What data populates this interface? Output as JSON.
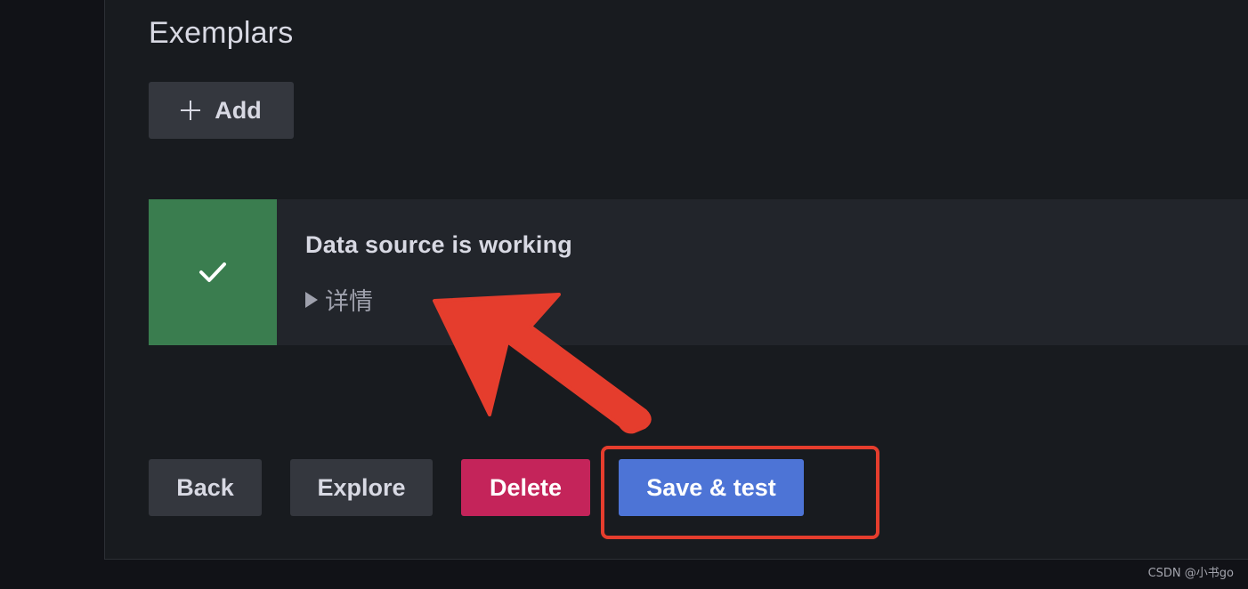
{
  "section": {
    "title": "Exemplars",
    "add_label": "Add"
  },
  "alert": {
    "status": "success",
    "title": "Data source is working",
    "details_label": "详情",
    "accent_color": "#3a7d4f"
  },
  "actions": {
    "back_label": "Back",
    "explore_label": "Explore",
    "delete_label": "Delete",
    "save_test_label": "Save & test"
  },
  "colors": {
    "background": "#181b1f",
    "secondary_button": "#34373e",
    "delete_button": "#c4245a",
    "primary_button": "#4d74d6",
    "annotation_red": "#e53d2d"
  },
  "watermark": "CSDN @小书go"
}
